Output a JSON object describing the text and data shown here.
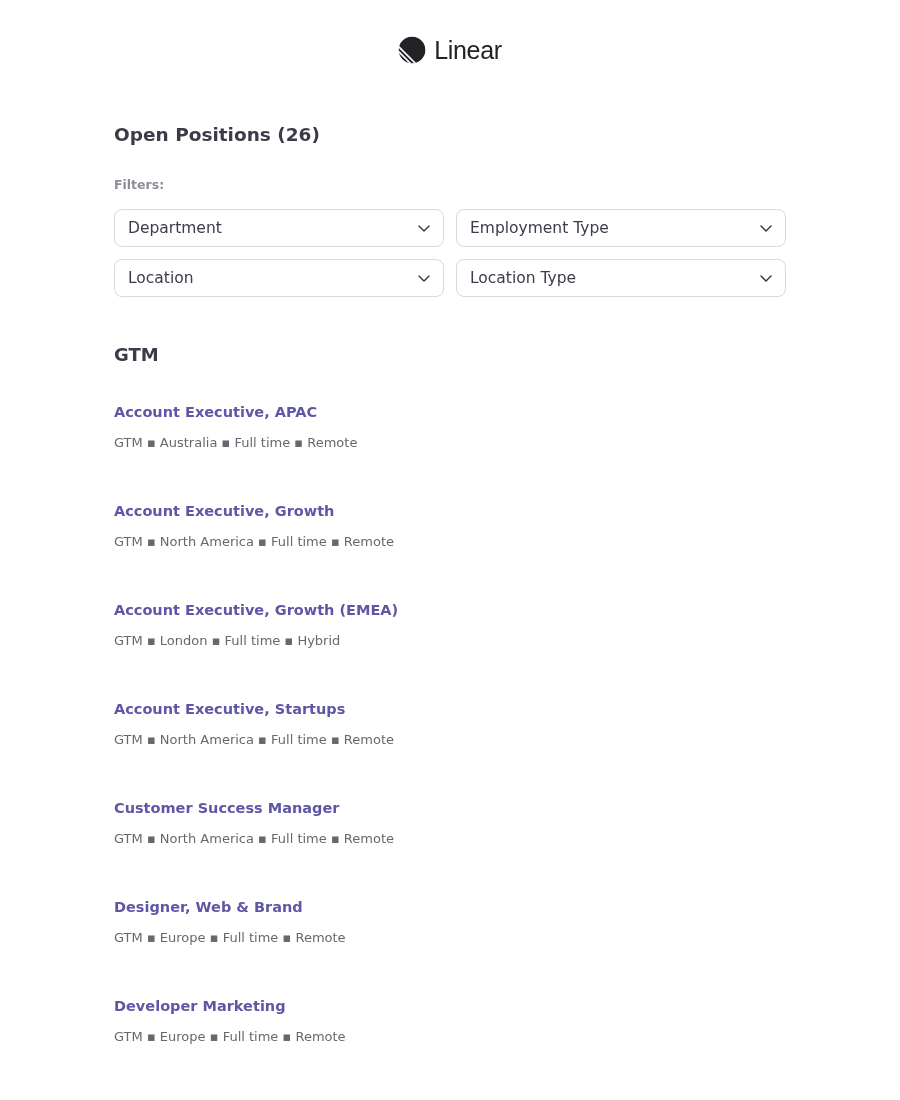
{
  "logo": {
    "name": "Linear"
  },
  "heading": "Open Positions (26)",
  "filters": {
    "label": "Filters:",
    "dropdowns": [
      {
        "label": "Department"
      },
      {
        "label": "Employment Type"
      },
      {
        "label": "Location"
      },
      {
        "label": "Location Type"
      }
    ]
  },
  "sections": [
    {
      "title": "GTM",
      "jobs": [
        {
          "title": "Account Executive, APAC",
          "details": "GTM ▪ Australia ▪ Full time ▪ Remote"
        },
        {
          "title": "Account Executive, Growth",
          "details": "GTM ▪ North America ▪ Full time ▪ Remote"
        },
        {
          "title": "Account Executive, Growth (EMEA)",
          "details": "GTM ▪ London ▪ Full time ▪ Hybrid"
        },
        {
          "title": "Account Executive, Startups",
          "details": "GTM ▪ North America ▪ Full time ▪ Remote"
        },
        {
          "title": "Customer Success Manager",
          "details": "GTM ▪ North America ▪ Full time ▪ Remote"
        },
        {
          "title": "Designer, Web & Brand",
          "details": "GTM ▪ Europe ▪ Full time ▪ Remote"
        },
        {
          "title": "Developer Marketing",
          "details": "GTM ▪ Europe ▪ Full time ▪ Remote"
        }
      ]
    }
  ]
}
